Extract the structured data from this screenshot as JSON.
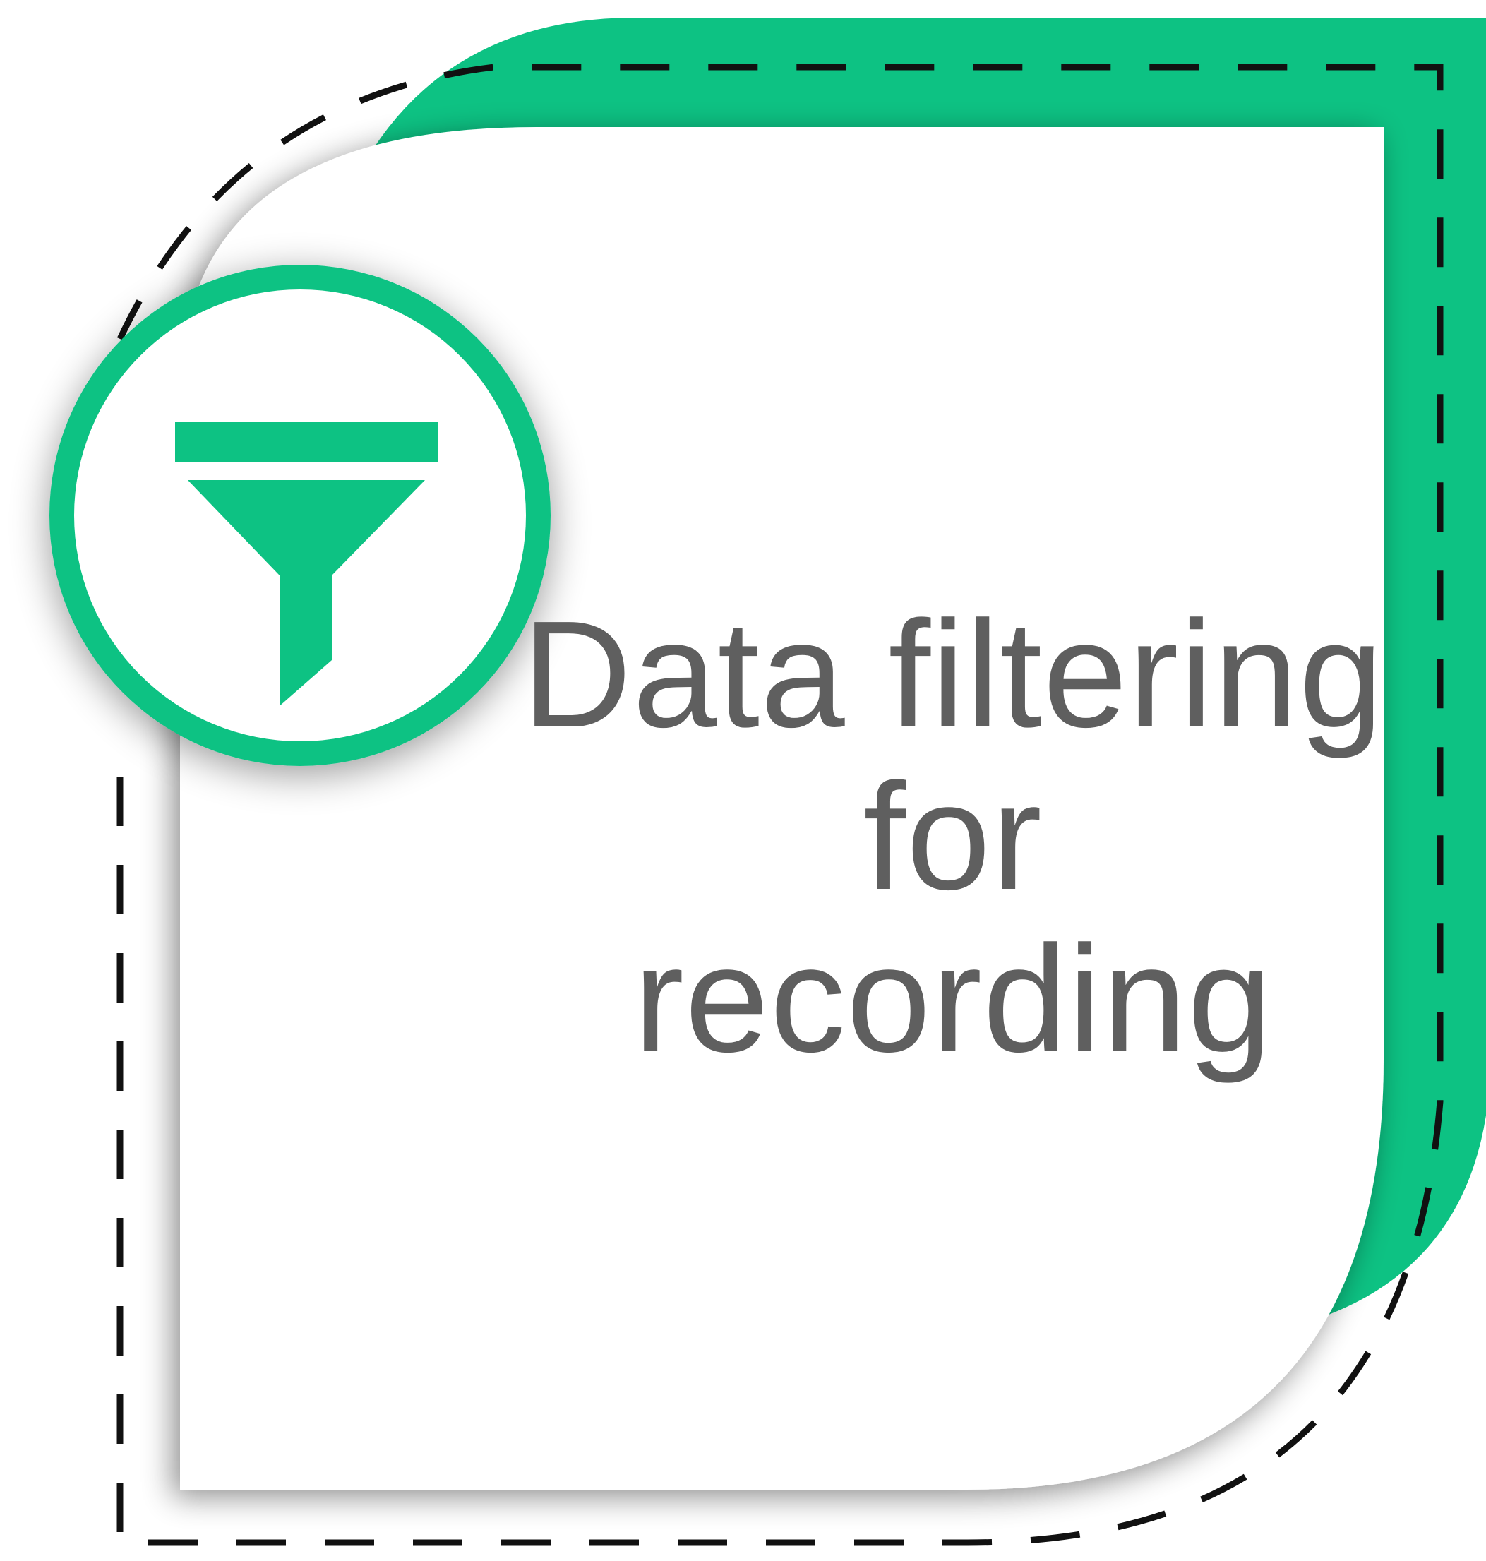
{
  "card": {
    "title_lines": [
      "Data filtering",
      "for",
      "recording"
    ],
    "icon": "filter-funnel-icon"
  },
  "colors": {
    "accent": "#0DC283",
    "text": "#5F5F5F",
    "dash": "#111111",
    "background": "#FFFFFF"
  }
}
